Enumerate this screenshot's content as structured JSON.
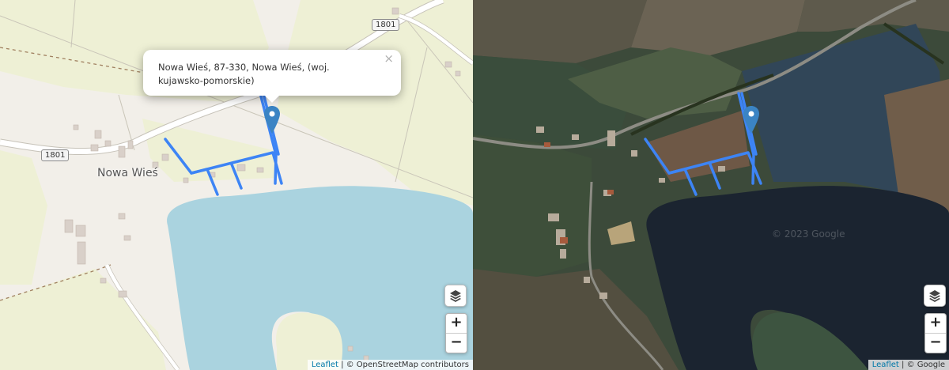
{
  "popup": {
    "text": "Nowa Wieś, 87-330, Nowa Wieś, (woj. kujawsko-pomorskie)",
    "close_label": "×"
  },
  "left_map": {
    "place_label": "Nowa Wieś",
    "road_shields": [
      "1801",
      "1801"
    ],
    "zoom_in": "+",
    "zoom_out": "−",
    "attribution_link": "Leaflet",
    "attribution_separator": "|",
    "attribution_text": "© OpenStreetMap contributors"
  },
  "right_map": {
    "watermark": "© 2023 Google",
    "zoom_in": "+",
    "zoom_out": "−",
    "attribution_link": "Leaflet",
    "attribution_separator": "|",
    "attribution_text": "© Google"
  },
  "colors": {
    "parcel_line": "#3d84f5",
    "marker": "#3b84c4",
    "water": "#aad3df",
    "land": "#f2efe9",
    "farmland": "#eef0d5",
    "satellite_water": "#1b2430"
  },
  "icons": [
    "layers-icon",
    "map-marker-icon",
    "close-icon"
  ]
}
